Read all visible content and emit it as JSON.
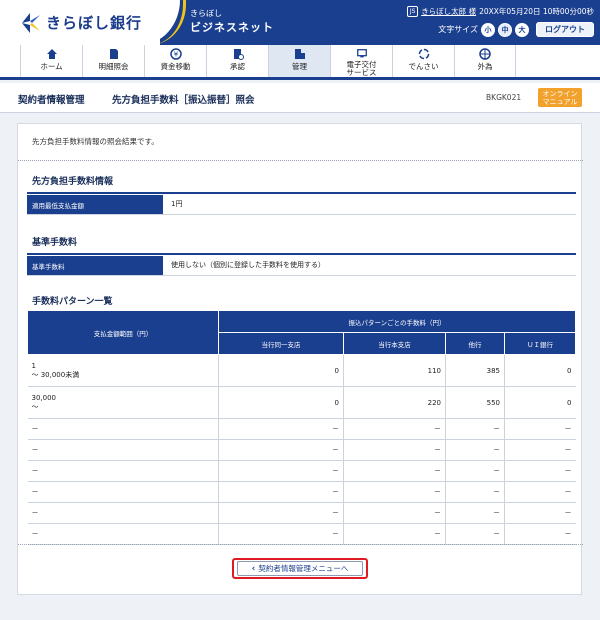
{
  "header": {
    "bank_name": "きらぼし銀行",
    "service_small": "きらぼし",
    "service_name": "ビジネスネット",
    "user_icon": "JS",
    "user_name": "きらぼし太郎 様",
    "login_time": "20XX年05月20日 10時00分00秒",
    "font_size_label": "文字サイズ",
    "font_sizes": [
      "小",
      "中",
      "大"
    ],
    "logout_label": "ログアウト"
  },
  "nav": [
    {
      "label": "ホーム",
      "icon": "home-icon"
    },
    {
      "label": "明細照会",
      "icon": "document-icon"
    },
    {
      "label": "資金移動",
      "icon": "yen-transfer-icon"
    },
    {
      "label": "承認",
      "icon": "approval-icon"
    },
    {
      "label": "管理",
      "icon": "management-icon"
    },
    {
      "label": "電子交付\nサービス",
      "icon": "e-delivery-icon"
    },
    {
      "label": "でんさい",
      "icon": "densai-icon"
    },
    {
      "label": "外為",
      "icon": "forex-icon"
    }
  ],
  "titlebar": {
    "crumb": "契約者情報管理",
    "title": "先方負担手数料［振込振替］照会",
    "screen_id": "BKGK021",
    "manual_line1": "オンライン",
    "manual_line2": "マニュアル"
  },
  "intro": "先方負担手数料情報の照会結果です。",
  "section1": {
    "title": "先方負担手数料情報",
    "key": "適用最低支払金額",
    "value": "1円"
  },
  "section2": {
    "title": "基準手数料",
    "key": "基準手数料",
    "value": "使用しない（個別に登録した手数料を使用する）"
  },
  "section3": {
    "title": "手数料パターン一覧",
    "col_range": "支払金額範囲（円）",
    "col_group": "振込パターンごとの手数料（円）",
    "cols": [
      "当行同一支店",
      "当行本支店",
      "他行",
      "ＵＩ銀行"
    ],
    "rows": [
      {
        "range1": "1",
        "range2": "～ 30,000未満",
        "c1": "0",
        "c2": "110",
        "c3": "385",
        "c4": "0"
      },
      {
        "range1": "30,000",
        "range2": "～",
        "c1": "0",
        "c2": "220",
        "c3": "550",
        "c4": "0"
      },
      {
        "range1": "－",
        "range2": "",
        "c1": "－",
        "c2": "－",
        "c3": "－",
        "c4": "－"
      },
      {
        "range1": "－",
        "range2": "",
        "c1": "－",
        "c2": "－",
        "c3": "－",
        "c4": "－"
      },
      {
        "range1": "－",
        "range2": "",
        "c1": "－",
        "c2": "－",
        "c3": "－",
        "c4": "－"
      },
      {
        "range1": "－",
        "range2": "",
        "c1": "－",
        "c2": "－",
        "c3": "－",
        "c4": "－"
      },
      {
        "range1": "－",
        "range2": "",
        "c1": "－",
        "c2": "－",
        "c3": "－",
        "c4": "－"
      },
      {
        "range1": "－",
        "range2": "",
        "c1": "－",
        "c2": "－",
        "c3": "－",
        "c4": "－"
      }
    ]
  },
  "back_button": "契約者情報管理メニューへ",
  "colors": {
    "brand": "#1b3f8f",
    "accent": "#f0c419",
    "manual": "#f2a22c",
    "highlight": "#e01a22"
  }
}
